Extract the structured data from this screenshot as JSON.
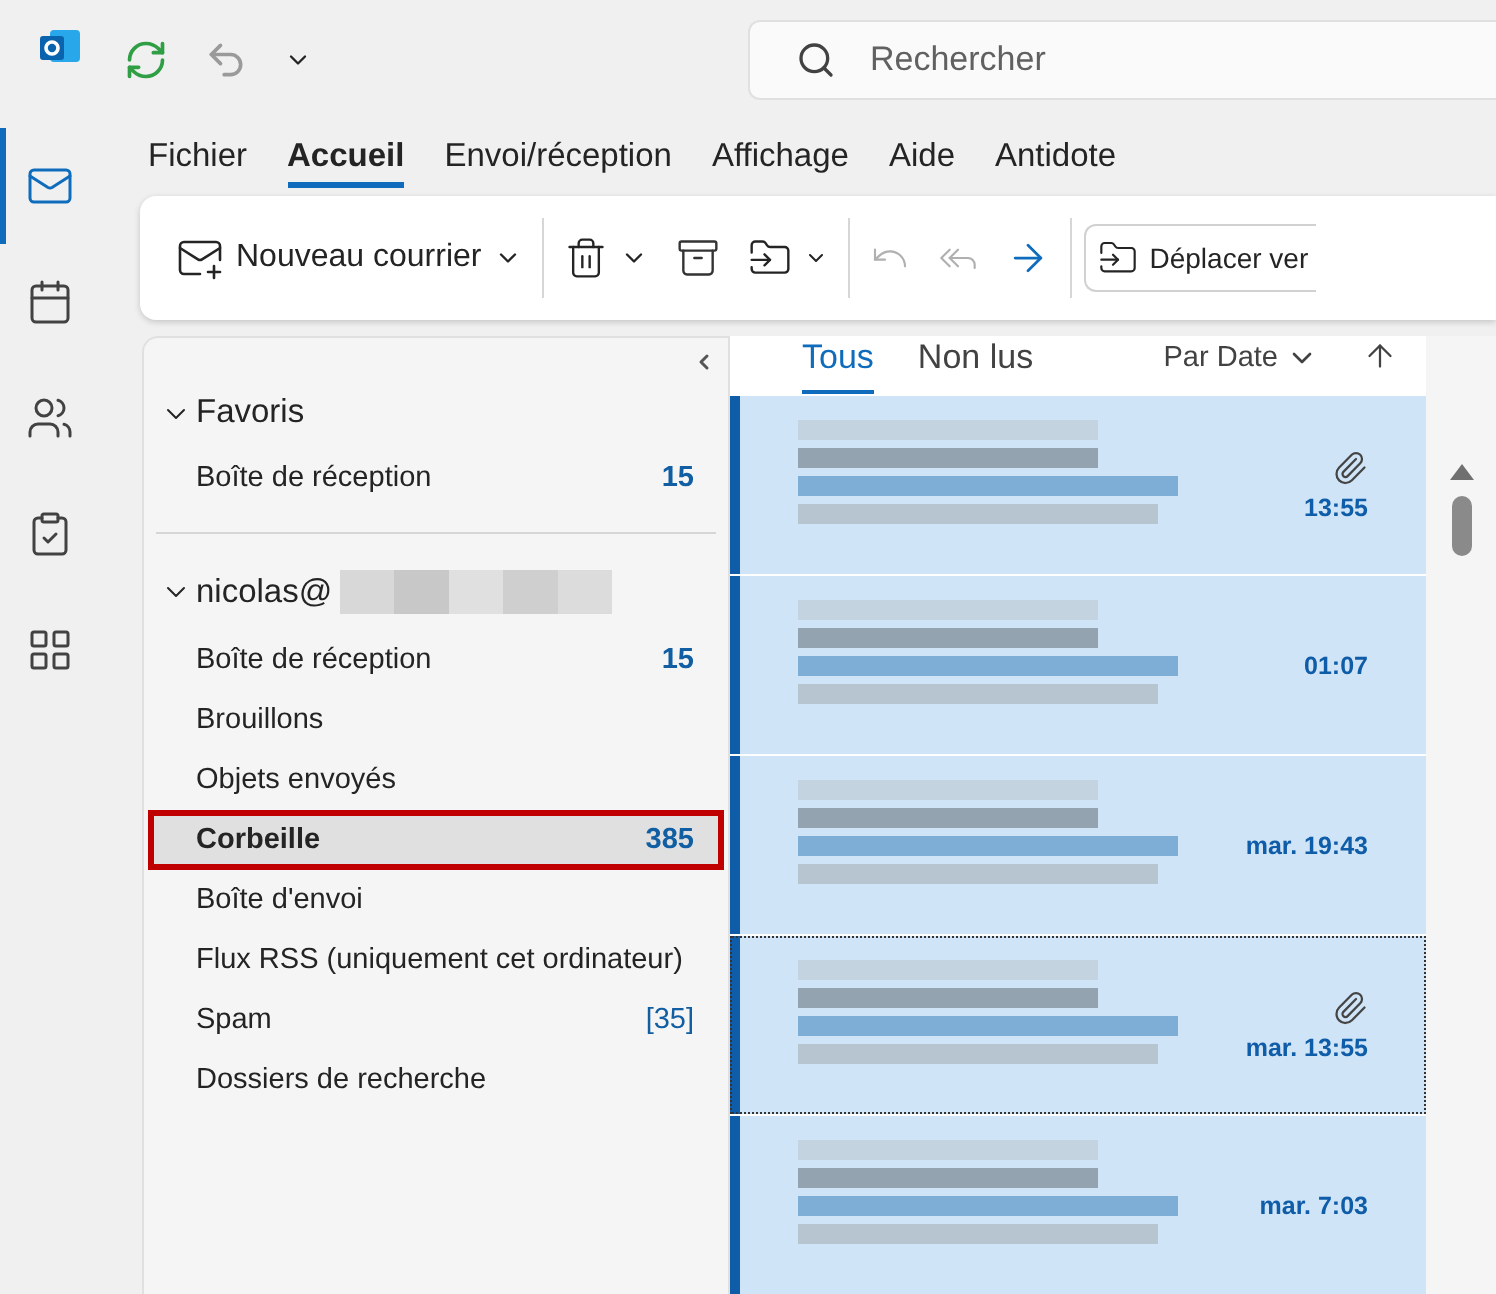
{
  "rail": [
    {
      "kind": "mail",
      "selected": true
    },
    {
      "kind": "calendar",
      "selected": false
    },
    {
      "kind": "people",
      "selected": false
    },
    {
      "kind": "tasks",
      "selected": false
    },
    {
      "kind": "apps",
      "selected": false
    }
  ],
  "search": {
    "placeholder": "Rechercher"
  },
  "ribbon_tabs": [
    {
      "label": "Fichier",
      "selected": false
    },
    {
      "label": "Accueil",
      "selected": true
    },
    {
      "label": "Envoi/réception",
      "selected": false
    },
    {
      "label": "Affichage",
      "selected": false
    },
    {
      "label": "Aide",
      "selected": false
    },
    {
      "label": "Antidote",
      "selected": false
    }
  ],
  "toolbar": {
    "new_mail": "Nouveau courrier",
    "move_to": "Déplacer ver"
  },
  "folder_groups": [
    {
      "label": "Favoris",
      "expanded": true,
      "items": [
        {
          "label": "Boîte de réception",
          "count": "15",
          "count_bold": true,
          "selected": false,
          "highlighted": false
        }
      ]
    },
    {
      "label": "nicolas@",
      "expanded": true,
      "redacted_suffix": true,
      "items": [
        {
          "label": "Boîte de réception",
          "count": "15",
          "count_bold": true,
          "selected": false,
          "highlighted": false
        },
        {
          "label": "Brouillons",
          "selected": false,
          "highlighted": false
        },
        {
          "label": "Objets envoyés",
          "selected": false,
          "highlighted": false
        },
        {
          "label": "Corbeille",
          "count": "385",
          "count_bold": true,
          "selected": true,
          "highlighted": true
        },
        {
          "label": "Boîte d'envoi",
          "selected": false,
          "highlighted": false
        },
        {
          "label": "Flux RSS (uniquement cet ordinateur)",
          "selected": false,
          "highlighted": false
        },
        {
          "label": "Spam",
          "count": "[35]",
          "count_bold": false,
          "selected": false,
          "highlighted": false
        },
        {
          "label": "Dossiers de recherche",
          "selected": false,
          "highlighted": false
        }
      ]
    }
  ],
  "list_tabs": [
    {
      "label": "Tous",
      "selected": true
    },
    {
      "label": "Non lus",
      "selected": false
    }
  ],
  "sort": {
    "label": "Par Date"
  },
  "messages": [
    {
      "time": "13:55",
      "attachment": true,
      "unread": true,
      "focused": false
    },
    {
      "time": "01:07",
      "attachment": false,
      "unread": true,
      "focused": false
    },
    {
      "time": "mar. 19:43",
      "attachment": false,
      "unread": true,
      "focused": false
    },
    {
      "time": "mar. 13:55",
      "attachment": true,
      "unread": true,
      "focused": true
    },
    {
      "time": "mar. 7:03",
      "attachment": false,
      "unread": true,
      "focused": false
    }
  ]
}
